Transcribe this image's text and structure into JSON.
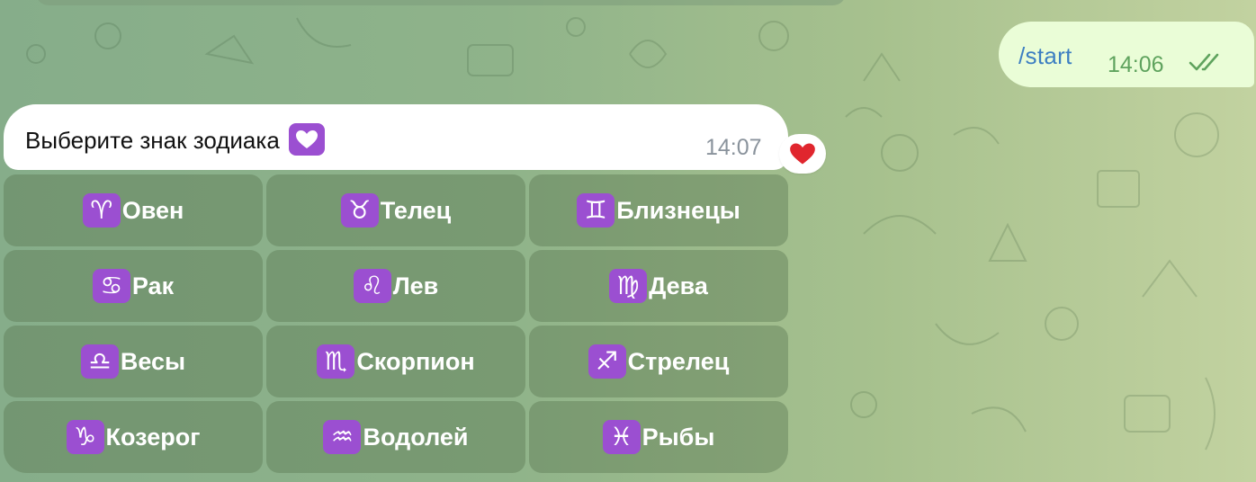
{
  "accent_colors": {
    "outgoing_bubble": "#eafdd7",
    "incoming_bubble": "#ffffff",
    "link": "#3d7fc2",
    "outgoing_time": "#5fa35e",
    "incoming_time": "#8a939c",
    "zodiac_icon_bg": "#9b4fd1",
    "reaction_heart": "#e0262e"
  },
  "outgoing_message": {
    "text": "/start",
    "time": "14:06",
    "status_icon": "double-check-icon"
  },
  "incoming_message": {
    "text": "Выберите знак зодиака",
    "emoji_icon": "purple-heart-emoji",
    "time": "14:07",
    "reaction": "red-heart-emoji"
  },
  "keyboard": {
    "buttons": [
      {
        "symbol": "♈",
        "icon": "aries-icon",
        "label": "Овен"
      },
      {
        "symbol": "♉",
        "icon": "taurus-icon",
        "label": "Телец"
      },
      {
        "symbol": "♊",
        "icon": "gemini-icon",
        "label": "Близнецы"
      },
      {
        "symbol": "♋",
        "icon": "cancer-icon",
        "label": "Рак"
      },
      {
        "symbol": "♌",
        "icon": "leo-icon",
        "label": "Лев"
      },
      {
        "symbol": "♍",
        "icon": "virgo-icon",
        "label": "Дева"
      },
      {
        "symbol": "♎",
        "icon": "libra-icon",
        "label": "Весы"
      },
      {
        "symbol": "♏",
        "icon": "scorpio-icon",
        "label": "Скорпион"
      },
      {
        "symbol": "♐",
        "icon": "sagittarius-icon",
        "label": "Стрелец"
      },
      {
        "symbol": "♑",
        "icon": "capricorn-icon",
        "label": "Козерог"
      },
      {
        "symbol": "♒",
        "icon": "aquarius-icon",
        "label": "Водолей"
      },
      {
        "symbol": "♓",
        "icon": "pisces-icon",
        "label": "Рыбы"
      }
    ]
  }
}
